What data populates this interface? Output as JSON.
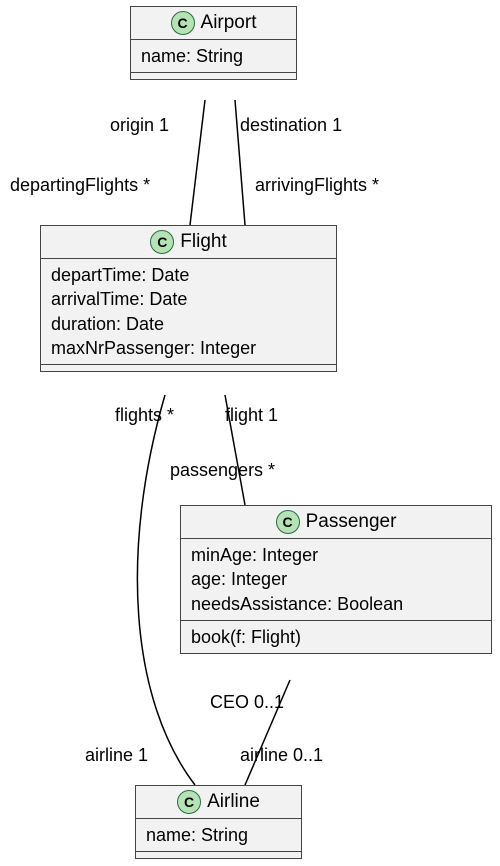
{
  "class_icon_letter": "C",
  "classes": {
    "airport": {
      "name": "Airport",
      "attrs": [
        "name: String"
      ]
    },
    "flight": {
      "name": "Flight",
      "attrs": [
        "departTime: Date",
        "arrivalTime: Date",
        "duration: Date",
        "maxNrPassenger: Integer"
      ]
    },
    "passenger": {
      "name": "Passenger",
      "attrs": [
        "minAge: Integer",
        "age: Integer",
        "needsAssistance: Boolean"
      ],
      "ops": [
        "book(f: Flight)"
      ]
    },
    "airline": {
      "name": "Airline",
      "attrs": [
        "name: String"
      ]
    }
  },
  "labels": {
    "origin": "origin 1",
    "destination": "destination 1",
    "departingFlights": "departingFlights *",
    "arrivingFlights": "arrivingFlights *",
    "flights_star": "flights *",
    "flight_one": "flight 1",
    "passengers_star": "passengers *",
    "ceo": "CEO 0..1",
    "airline_one": "airline 1",
    "airline_opt": "airline 0..1"
  }
}
